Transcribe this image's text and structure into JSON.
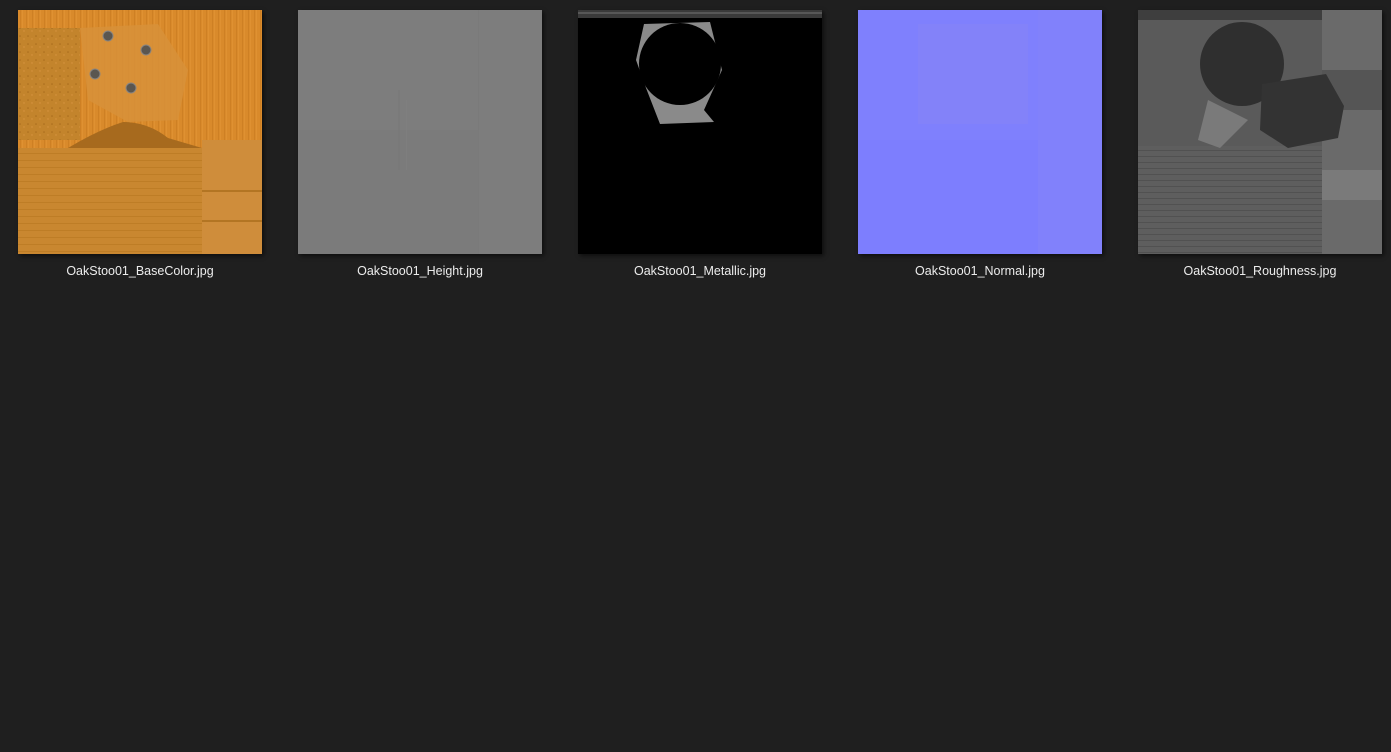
{
  "files": [
    {
      "name": "OakStoo01_BaseColor.jpg",
      "map": "base-color"
    },
    {
      "name": "OakStoo01_Height.jpg",
      "map": "height"
    },
    {
      "name": "OakStoo01_Metallic.jpg",
      "map": "metallic"
    },
    {
      "name": "OakStoo01_Normal.jpg",
      "map": "normal"
    },
    {
      "name": "OakStoo01_Roughness.jpg",
      "map": "roughness"
    }
  ],
  "colors": {
    "background": "#1f1f1f",
    "label_text": "#ececec"
  }
}
